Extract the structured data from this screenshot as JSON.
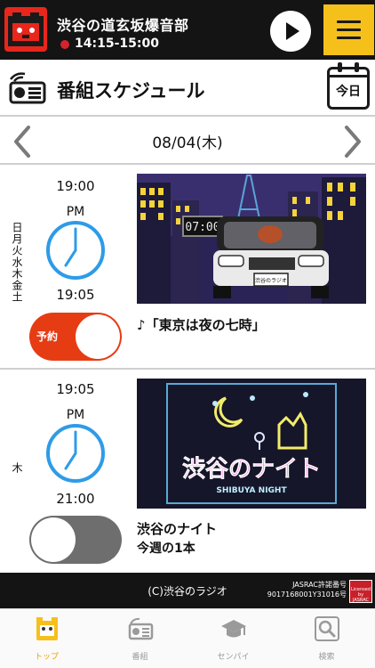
{
  "now_playing": {
    "title": "渋谷の道玄坂爆音部",
    "time": "14:15-15:00",
    "play_icon": "play-icon",
    "menu_icon": "hamburger-icon"
  },
  "header": {
    "title": "番組スケジュール",
    "today_label": "今日"
  },
  "date_nav": {
    "date": "08/04(木)"
  },
  "programs": [
    {
      "days": "日月火水木金土",
      "start": "19:00",
      "ampm": "PM",
      "end": "19:05",
      "reserved": true,
      "reserve_label": "予約",
      "title": "♪「東京は夜の七時」",
      "subtitle": "",
      "art_clock_text": "07:00",
      "art_plate_text": "渋谷のラジオ"
    },
    {
      "days": "木",
      "start": "19:05",
      "ampm": "PM",
      "end": "21:00",
      "reserved": false,
      "reserve_label": "",
      "title": "渋谷のナイト",
      "subtitle": "今週の1本",
      "art_neon_title": "渋谷のナイト",
      "art_neon_sub": "SHIBUYA NIGHT"
    }
  ],
  "footer": {
    "copyright": "(C)渋谷のラジオ",
    "jasrac_line1": "JASRAC許諾番号",
    "jasrac_line2": "9017168001Y31016号",
    "jasrac_logo_line1": "Licensed",
    "jasrac_logo_line2": "by",
    "jasrac_logo_line3": "JASRAC"
  },
  "tabs": [
    {
      "label": "トップ",
      "icon": "top-icon",
      "active": true
    },
    {
      "label": "番組",
      "icon": "radio-icon",
      "active": false
    },
    {
      "label": "センパイ",
      "icon": "graduation-cap-icon",
      "active": false
    },
    {
      "label": "検索",
      "icon": "search-icon",
      "active": false
    }
  ],
  "colors": {
    "accent_yellow": "#f6c01b",
    "brand_red": "#e9261c",
    "reserve_on": "#e63c14",
    "reserve_off": "#6e6e6e",
    "clock_blue": "#2e9be8",
    "tab_active": "#e8a40c"
  }
}
